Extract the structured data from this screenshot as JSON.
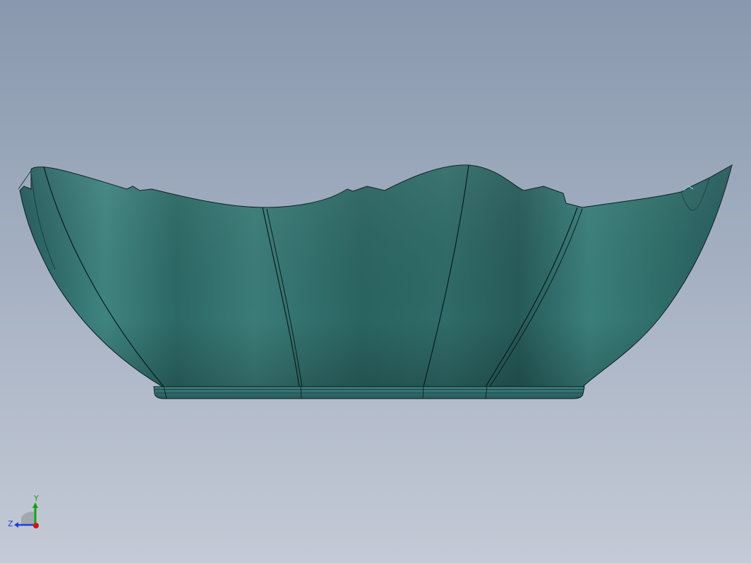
{
  "viewport": {
    "background_top": "#8998ae",
    "background_bottom": "#c4cad6"
  },
  "model": {
    "name": "",
    "body_color": "#2f6f6c",
    "body_highlight": "#3f8783",
    "body_shadow": "#1f4f4d",
    "edge_color": "#0b1b1b"
  },
  "triad": {
    "x_label": "",
    "y_label": "Y",
    "z_label": "Z",
    "x_color": "#d11414",
    "y_color": "#12a312",
    "z_color": "#1f3fd1"
  }
}
